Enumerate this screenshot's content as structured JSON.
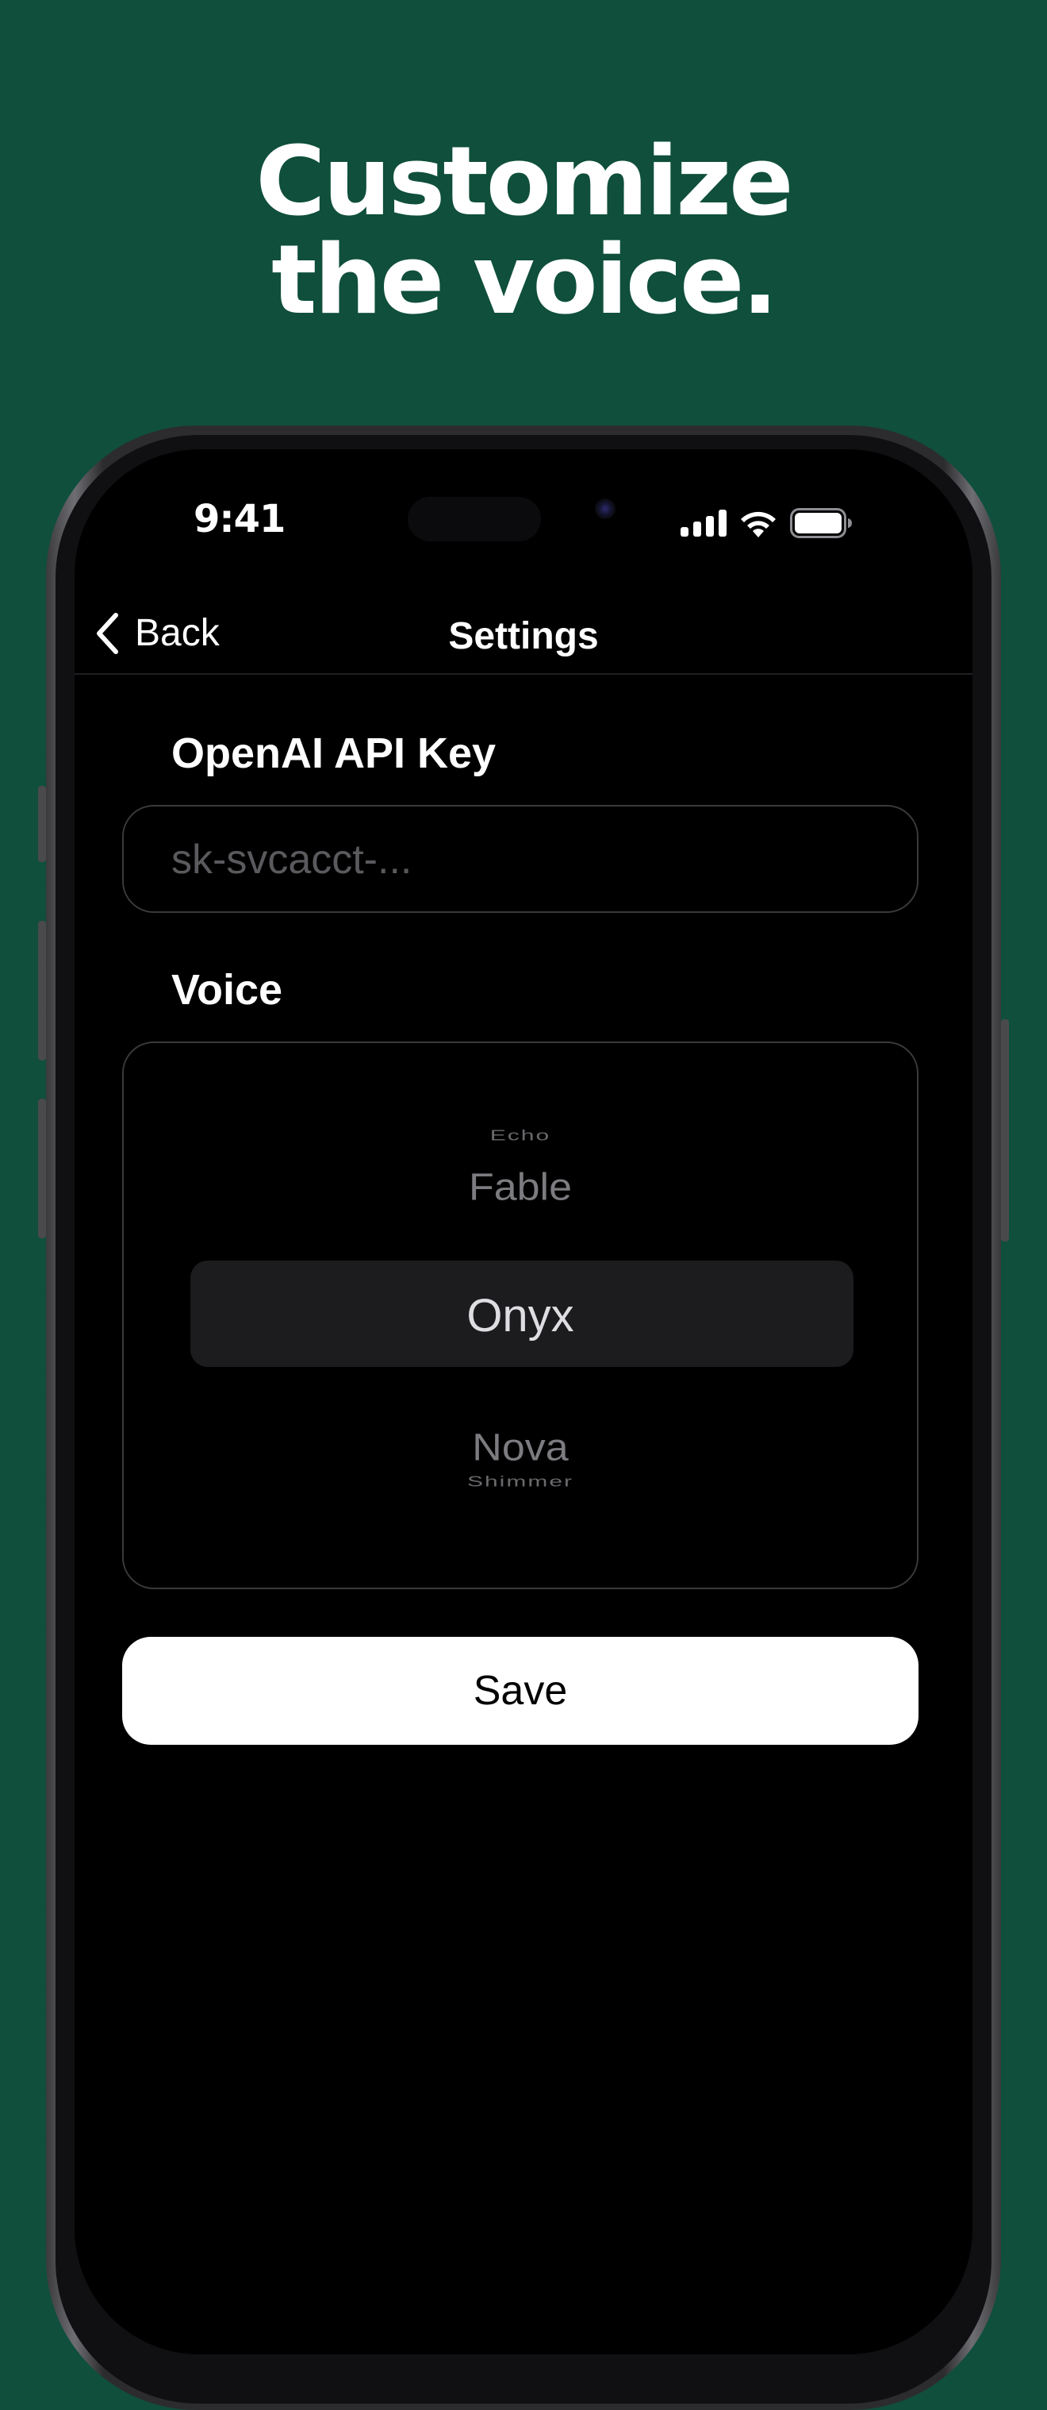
{
  "headline": {
    "line1": "Customize",
    "line2": "the voice."
  },
  "status_bar": {
    "time": "9:41",
    "icons": [
      "cellular-signal-icon",
      "wifi-icon",
      "battery-icon"
    ]
  },
  "nav": {
    "back_label": "Back",
    "title": "Settings"
  },
  "api_key": {
    "label": "OpenAI API Key",
    "placeholder": "sk-svcacct-..."
  },
  "voice": {
    "label": "Voice",
    "options_visible": [
      "Echo",
      "Fable",
      "Onyx",
      "Nova",
      "Shimmer"
    ],
    "selected": "Onyx"
  },
  "save_label": "Save",
  "colors": {
    "background": "#0f4f3b",
    "screen": "#000000",
    "button": "#ffffff"
  }
}
